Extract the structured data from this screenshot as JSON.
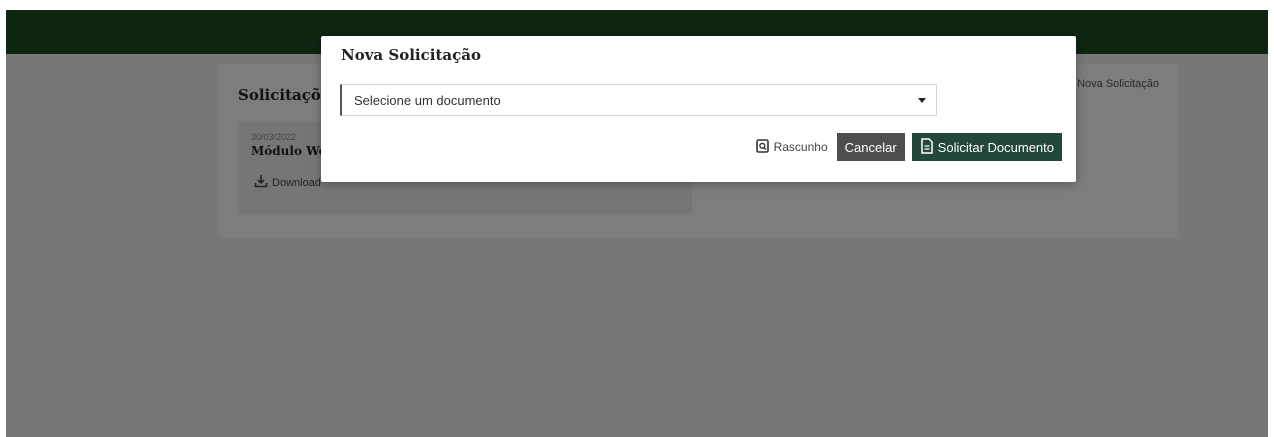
{
  "background": {
    "section_title": "Solicitações",
    "new_request_link": "Nova Solicitação",
    "document": {
      "date": "30/03/2022",
      "title": "Módulo Web",
      "download_label": "Download"
    }
  },
  "modal": {
    "title": "Nova Solicitação",
    "select_value": "Selecione um documento",
    "actions": {
      "draft_label": "Rascunho",
      "cancel_label": "Cancelar",
      "submit_label": "Solicitar Documento"
    }
  },
  "colors": {
    "topbar": "#1c4a22",
    "submit_button": "#23473a",
    "cancel_button": "#4e4e4e"
  },
  "icons": {
    "draft": "search-document-icon",
    "download": "download-icon",
    "submit": "document-icon",
    "select_caret": "caret-down-icon"
  }
}
